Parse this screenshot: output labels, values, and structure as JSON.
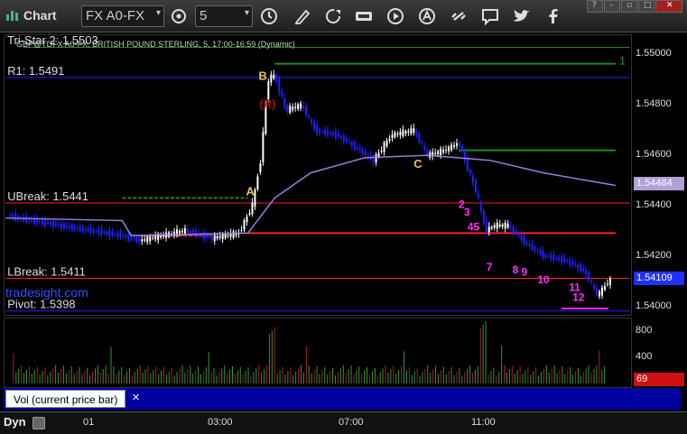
{
  "toolbar": {
    "app_title": "Chart",
    "symbol": "FX A0-FX",
    "interval": "5",
    "icons": [
      "gear-icon",
      "clock-icon",
      "pencil-icon",
      "refresh-icon",
      "get-icon",
      "play-icon",
      "alert-icon",
      "link-icon",
      "chat-icon",
      "twitter-icon",
      "facebook-icon"
    ]
  },
  "chart": {
    "header": "GBP@TDFX A0-FX, BRITISH POUND STERLING, 5, 17:00-16:59 (Dynamic)",
    "tri_star_label": "Tri-Star 2: 1.5503",
    "levels": [
      {
        "label": "R1: 1.5491",
        "value": 1.5491,
        "color": "#2020ff"
      },
      {
        "label": "UBreak: 1.5441",
        "value": 1.5441,
        "color": "#ff2020"
      },
      {
        "label": "LBreak: 1.5411",
        "value": 1.5411,
        "color": "#ff2020"
      },
      {
        "label": "Pivot: 1.5398",
        "value": 1.5398,
        "color": "#2020ff"
      }
    ],
    "watermark": "tradesight.com",
    "price_ticks": [
      "1.55000",
      "1.54800",
      "1.54600",
      "1.54400",
      "1.54200",
      "1.54000"
    ],
    "price_tick_values": [
      1.55,
      1.548,
      1.546,
      1.544,
      1.542,
      1.54
    ],
    "current_price_label": "1.54109",
    "ma_price_label": "1.54484",
    "letters": [
      "A",
      "B",
      "(R)",
      "C"
    ],
    "counts_magenta": [
      "2",
      "3",
      "4",
      "5",
      "7",
      "8",
      "9",
      "10",
      "11",
      "12"
    ],
    "green_marker": "1",
    "colors": {
      "up": "#ffffff",
      "down": "#2020ff",
      "ma": "#9a7fdc",
      "green": "#1f8a1f",
      "magenta": "#ff2cff",
      "yellow": "#e8c64a",
      "darkred": "#a01010"
    }
  },
  "volume": {
    "axis_ticks": [
      "800",
      "400"
    ],
    "axis_tick_values": [
      800,
      400
    ],
    "current_label": "69",
    "current_value": 69,
    "legend": "Vol (current price bar)"
  },
  "time_axis": {
    "dyn_label": "Dyn",
    "labels": [
      "01",
      "03:00",
      "07:00",
      "11:00"
    ]
  }
}
